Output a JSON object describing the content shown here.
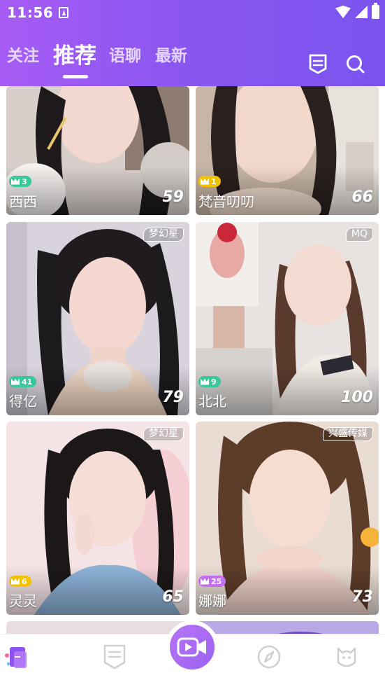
{
  "status_bar": {
    "time": "11:56"
  },
  "header": {
    "tabs": [
      {
        "label": "关注"
      },
      {
        "label": "推荐",
        "active": true
      },
      {
        "label": "语聊"
      },
      {
        "label": "最新"
      }
    ],
    "icons": [
      "list-icon",
      "search-icon"
    ]
  },
  "cards": [
    {
      "name": "西西",
      "level": "3",
      "score": "59",
      "tag": "",
      "level_color": "#37c89a"
    },
    {
      "name": "梵音叨叨",
      "level": "1",
      "score": "66",
      "tag": "",
      "level_color": "#f2c200"
    },
    {
      "name": "得亿",
      "level": "41",
      "score": "79",
      "tag": "梦幻星",
      "level_color": "#37c89a"
    },
    {
      "name": "北北",
      "level": "9",
      "score": "100",
      "tag": "MQ",
      "level_color": "#37c89a"
    },
    {
      "name": "灵灵",
      "level": "6",
      "score": "65",
      "tag": "梦幻星",
      "level_color": "#f2c200"
    },
    {
      "name": "娜娜",
      "level": "25",
      "score": "73",
      "tag": "兴盛传媒",
      "level_color": "#c46ff0"
    }
  ],
  "bottom_nav": {
    "items": [
      "home-icon",
      "list-icon",
      "video-call-icon",
      "compass-icon",
      "profile-icon"
    ]
  },
  "colors": {
    "header_start": "#a65cf5",
    "header_end": "#7a53ee",
    "accent": "#9c63f0"
  }
}
